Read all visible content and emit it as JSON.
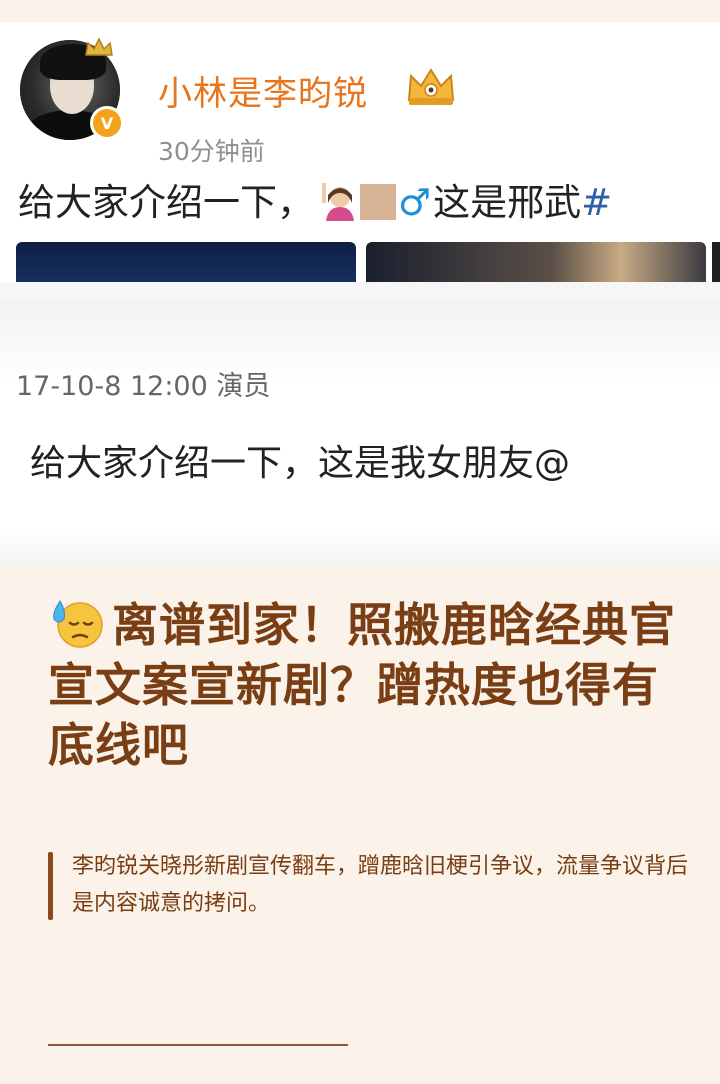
{
  "post": {
    "username": "小林是李昀锐",
    "time": "30分钟前",
    "text_before": "给大家介绍一下，",
    "male_sign": "♂",
    "text_after": "这是邢武",
    "hash": "#",
    "icons": [
      "avatar",
      "verified-badge",
      "crown-icon",
      "person-raising-hand-emoji",
      "male-sign-emoji"
    ]
  },
  "old_post": {
    "date_role": "17-10-8 12:00  演员",
    "text": "给大家介绍一下，这是我女朋友@"
  },
  "article": {
    "headline": "离谱到家！照搬鹿晗经典官宣文案宣新剧？蹭热度也得有底线吧",
    "headline_icon": "downcast-face-with-sweat-emoji",
    "summary": "李昀锐关晓彤新剧宣传翻车，蹭鹿晗旧梗引争议，流量争议背后是内容诚意的拷问。"
  },
  "colors": {
    "username": "#e8741c",
    "headline": "#7a3e14",
    "background": "#fbf3ea",
    "accent_bar": "#8a4a1e"
  }
}
